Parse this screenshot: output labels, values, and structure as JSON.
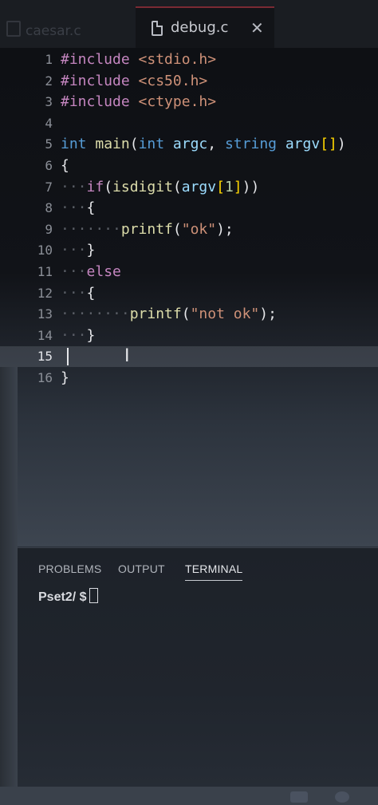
{
  "tabs": {
    "inactive_label": "caesar.c",
    "active_label": "debug.c"
  },
  "editor": {
    "lines": [
      {
        "num": "1",
        "tokens": [
          {
            "t": "#include ",
            "c": "pp"
          },
          {
            "t": "<stdio.h>",
            "c": "inc"
          }
        ]
      },
      {
        "num": "2",
        "tokens": [
          {
            "t": "#include ",
            "c": "pp"
          },
          {
            "t": "<cs50.h>",
            "c": "inc"
          }
        ]
      },
      {
        "num": "3",
        "tokens": [
          {
            "t": "#include ",
            "c": "pp"
          },
          {
            "t": "<ctype.h>",
            "c": "inc"
          }
        ]
      },
      {
        "num": "4",
        "tokens": []
      },
      {
        "num": "5",
        "tokens": [
          {
            "t": "int ",
            "c": "kw"
          },
          {
            "t": "main",
            "c": "fn"
          },
          {
            "t": "(",
            "c": ""
          },
          {
            "t": "int ",
            "c": "kw"
          },
          {
            "t": "argc",
            "c": "var"
          },
          {
            "t": ", ",
            "c": ""
          },
          {
            "t": "string ",
            "c": "kw"
          },
          {
            "t": "argv",
            "c": "var"
          },
          {
            "t": "[]",
            "c": "brk"
          },
          {
            "t": ")",
            "c": ""
          }
        ]
      },
      {
        "num": "6",
        "tokens": [
          {
            "t": "{",
            "c": ""
          }
        ]
      },
      {
        "num": "7",
        "tokens": [
          {
            "t": "···",
            "c": "ws"
          },
          {
            "t": "if",
            "c": "pp"
          },
          {
            "t": "(",
            "c": ""
          },
          {
            "t": "isdigit",
            "c": "fn"
          },
          {
            "t": "(",
            "c": ""
          },
          {
            "t": "argv",
            "c": "var"
          },
          {
            "t": "[",
            "c": "brk"
          },
          {
            "t": "1",
            "c": "num"
          },
          {
            "t": "]",
            "c": "brk"
          },
          {
            "t": "))",
            "c": ""
          }
        ]
      },
      {
        "num": "8",
        "tokens": [
          {
            "t": "···",
            "c": "ws"
          },
          {
            "t": "{",
            "c": ""
          }
        ]
      },
      {
        "num": "9",
        "tokens": [
          {
            "t": "·······",
            "c": "ws"
          },
          {
            "t": "printf",
            "c": "fn"
          },
          {
            "t": "(",
            "c": ""
          },
          {
            "t": "\"ok\"",
            "c": "str"
          },
          {
            "t": ");",
            "c": ""
          }
        ]
      },
      {
        "num": "10",
        "tokens": [
          {
            "t": "···",
            "c": "ws"
          },
          {
            "t": "}",
            "c": ""
          }
        ]
      },
      {
        "num": "11",
        "tokens": [
          {
            "t": "···",
            "c": "ws"
          },
          {
            "t": "else",
            "c": "pp"
          }
        ]
      },
      {
        "num": "12",
        "tokens": [
          {
            "t": "···",
            "c": "ws"
          },
          {
            "t": "{",
            "c": ""
          }
        ]
      },
      {
        "num": "13",
        "tokens": [
          {
            "t": "········",
            "c": "ws"
          },
          {
            "t": "printf",
            "c": "fn"
          },
          {
            "t": "(",
            "c": ""
          },
          {
            "t": "\"not ok\"",
            "c": "str"
          },
          {
            "t": ");",
            "c": ""
          }
        ]
      },
      {
        "num": "14",
        "tokens": [
          {
            "t": "···",
            "c": "ws"
          },
          {
            "t": "}",
            "c": ""
          }
        ]
      },
      {
        "num": "15",
        "tokens": [],
        "current": true
      },
      {
        "num": "16",
        "tokens": [
          {
            "t": "}",
            "c": ""
          }
        ]
      }
    ]
  },
  "panel": {
    "tabs": [
      {
        "label": "PROBLEMS",
        "active": false
      },
      {
        "label": "OUTPUT",
        "active": false
      },
      {
        "label": "TERMINAL",
        "active": true
      }
    ],
    "terminal": {
      "prompt": "Pset2/ $"
    }
  }
}
